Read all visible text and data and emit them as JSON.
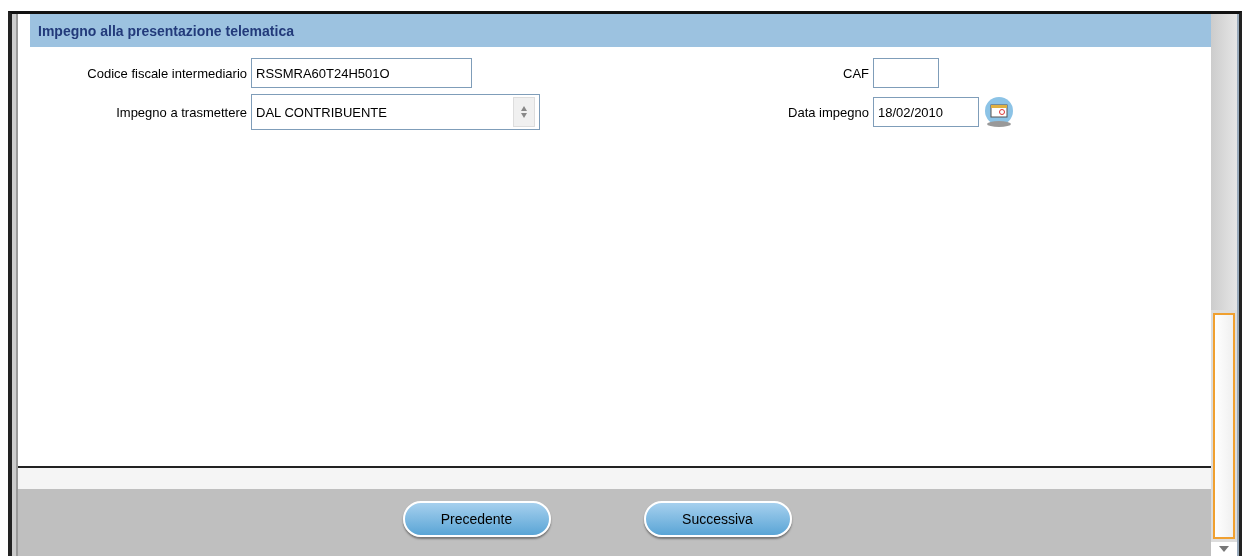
{
  "section": {
    "title": "Impegno alla presentazione telematica"
  },
  "rows": [
    {
      "left": {
        "kind": "text",
        "label": "Codice fiscale intermediario",
        "value": "RSSMRA60T24H501O"
      },
      "right": {
        "kind": "text",
        "label": "CAF"
      }
    },
    {
      "left": {
        "kind": "select",
        "label": "Impegno a trasmettere",
        "value": "DAL CONTRIBUENTE"
      },
      "right": {
        "kind": "date",
        "label": "Data impegno",
        "value": "18/02/2010"
      }
    }
  ],
  "buttons": [
    {
      "label": "Precedente"
    },
    {
      "label": "Successiva"
    }
  ]
}
